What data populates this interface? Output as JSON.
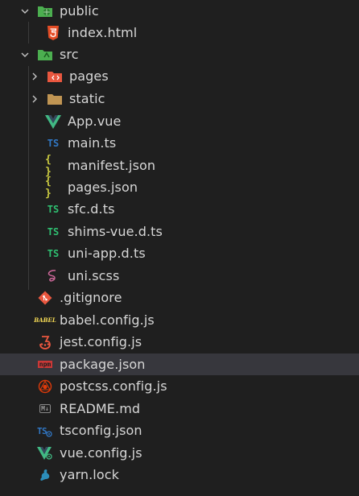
{
  "colors": {
    "background": "#1f1f1f",
    "selected_row": "#37373d",
    "text": "#d7d7d7",
    "ts_blue": "#3178c6",
    "ts_green": "#2fbf71",
    "vue_green": "#41b883",
    "json_yellow": "#cbcb41",
    "folder_green": "#4caf50",
    "folder_tan": "#c09553",
    "html_orange": "#e44d26",
    "git_red": "#e9573f"
  },
  "tree": [
    {
      "label": "public",
      "icon": "public-folder-icon",
      "expanded": true
    },
    {
      "label": "index.html",
      "icon": "html5-icon"
    },
    {
      "label": "src",
      "icon": "src-folder-icon",
      "expanded": true
    },
    {
      "label": "pages",
      "icon": "pages-folder-icon",
      "expanded": false
    },
    {
      "label": "static",
      "icon": "folder-icon",
      "expanded": false
    },
    {
      "label": "App.vue",
      "icon": "vue-icon"
    },
    {
      "label": "main.ts",
      "icon": "typescript-icon"
    },
    {
      "label": "manifest.json",
      "icon": "json-icon"
    },
    {
      "label": "pages.json",
      "icon": "json-icon"
    },
    {
      "label": "sfc.d.ts",
      "icon": "typescript-def-icon"
    },
    {
      "label": "shims-vue.d.ts",
      "icon": "typescript-def-icon"
    },
    {
      "label": "uni-app.d.ts",
      "icon": "typescript-def-icon"
    },
    {
      "label": "uni.scss",
      "icon": "sass-icon"
    },
    {
      "label": ".gitignore",
      "icon": "git-icon"
    },
    {
      "label": "babel.config.js",
      "icon": "babel-icon"
    },
    {
      "label": "jest.config.js",
      "icon": "jest-icon"
    },
    {
      "label": "package.json",
      "icon": "npm-icon",
      "selected": true
    },
    {
      "label": "postcss.config.js",
      "icon": "postcss-icon"
    },
    {
      "label": "README.md",
      "icon": "markdown-icon"
    },
    {
      "label": "tsconfig.json",
      "icon": "tsconfig-icon"
    },
    {
      "label": "vue.config.js",
      "icon": "vue-config-icon"
    },
    {
      "label": "yarn.lock",
      "icon": "yarn-icon"
    }
  ],
  "icon_text": {
    "ts": "TS",
    "json": "{ }",
    "md": "M↓",
    "npm": "npm",
    "babel": "BABEL"
  }
}
